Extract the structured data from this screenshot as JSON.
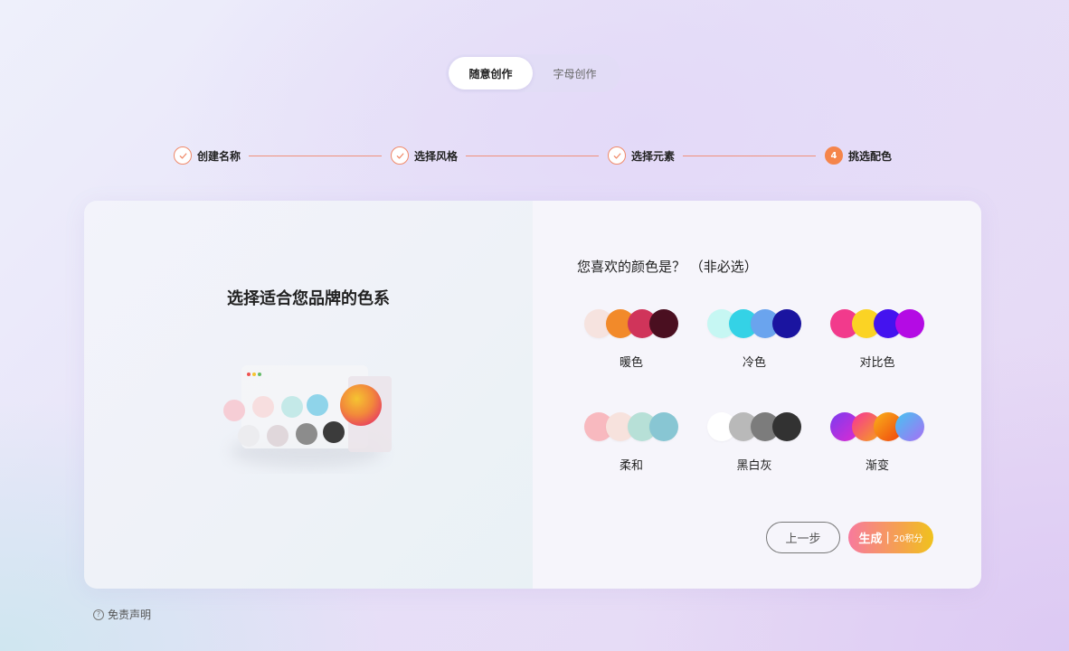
{
  "mode_tabs": [
    {
      "label": "随意创作",
      "active": true
    },
    {
      "label": "字母创作",
      "active": false
    }
  ],
  "steps": [
    {
      "label": "创建名称",
      "state": "done"
    },
    {
      "label": "选择风格",
      "state": "done"
    },
    {
      "label": "选择元素",
      "state": "done"
    },
    {
      "label": "挑选配色",
      "state": "current",
      "number": "4"
    }
  ],
  "left_panel": {
    "title": "选择适合您品牌的色系"
  },
  "right_panel": {
    "question": "您喜欢的颜色是？  （非必选）",
    "palettes": [
      {
        "label": "暖色",
        "colors": [
          "#f6e3df",
          "#f28a2a",
          "#d0345a",
          "#4a0f20"
        ]
      },
      {
        "label": "冷色",
        "colors": [
          "#c6f7f3",
          "#34d2e6",
          "#6aa4ee",
          "#1a14a0"
        ]
      },
      {
        "label": "对比色",
        "colors": [
          "#f23a8c",
          "#fbd324",
          "#4413ef",
          "#b40be4"
        ]
      },
      {
        "label": "柔和",
        "colors": [
          "#f8b9bf",
          "#f7e2dd",
          "#b7e0d7",
          "#88c6d3"
        ]
      },
      {
        "label": "黑白灰",
        "colors": [
          "#ffffff",
          "#b9b9b9",
          "#7c7c7c",
          "#323232"
        ]
      },
      {
        "label": "渐变",
        "colors": [
          "#b832e5",
          "#f04e8a",
          "#f97316",
          "#7aa0f5"
        ]
      }
    ],
    "prev_button": "上一步",
    "generate_button": {
      "label": "生成",
      "separator": "|",
      "cost": "20积分"
    }
  },
  "footer": {
    "disclaimer": "免责声明"
  },
  "colors": {
    "accent_orange": "#f5854b",
    "step_line": "#f0907a"
  }
}
